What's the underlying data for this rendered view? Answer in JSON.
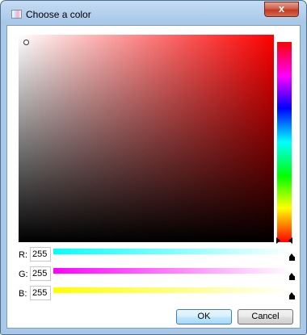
{
  "window": {
    "title": "Choose a color",
    "close_glyph": "x"
  },
  "icons": {
    "app": "color-picker-icon",
    "close": "close-icon"
  },
  "picker": {
    "hue_color": "#ff0000",
    "selected_color": "#ffffff"
  },
  "rgb": [
    {
      "label": "R:",
      "value": "255",
      "track_color": "#00ffff"
    },
    {
      "label": "G:",
      "value": "255",
      "track_color": "#ff00ff"
    },
    {
      "label": "B:",
      "value": "255",
      "track_color": "#ffff00"
    }
  ],
  "buttons": {
    "ok_label": "OK",
    "cancel_label": "Cancel"
  },
  "colors": {
    "title_bar": "#a9c8e8",
    "close_button": "#c03a22"
  }
}
